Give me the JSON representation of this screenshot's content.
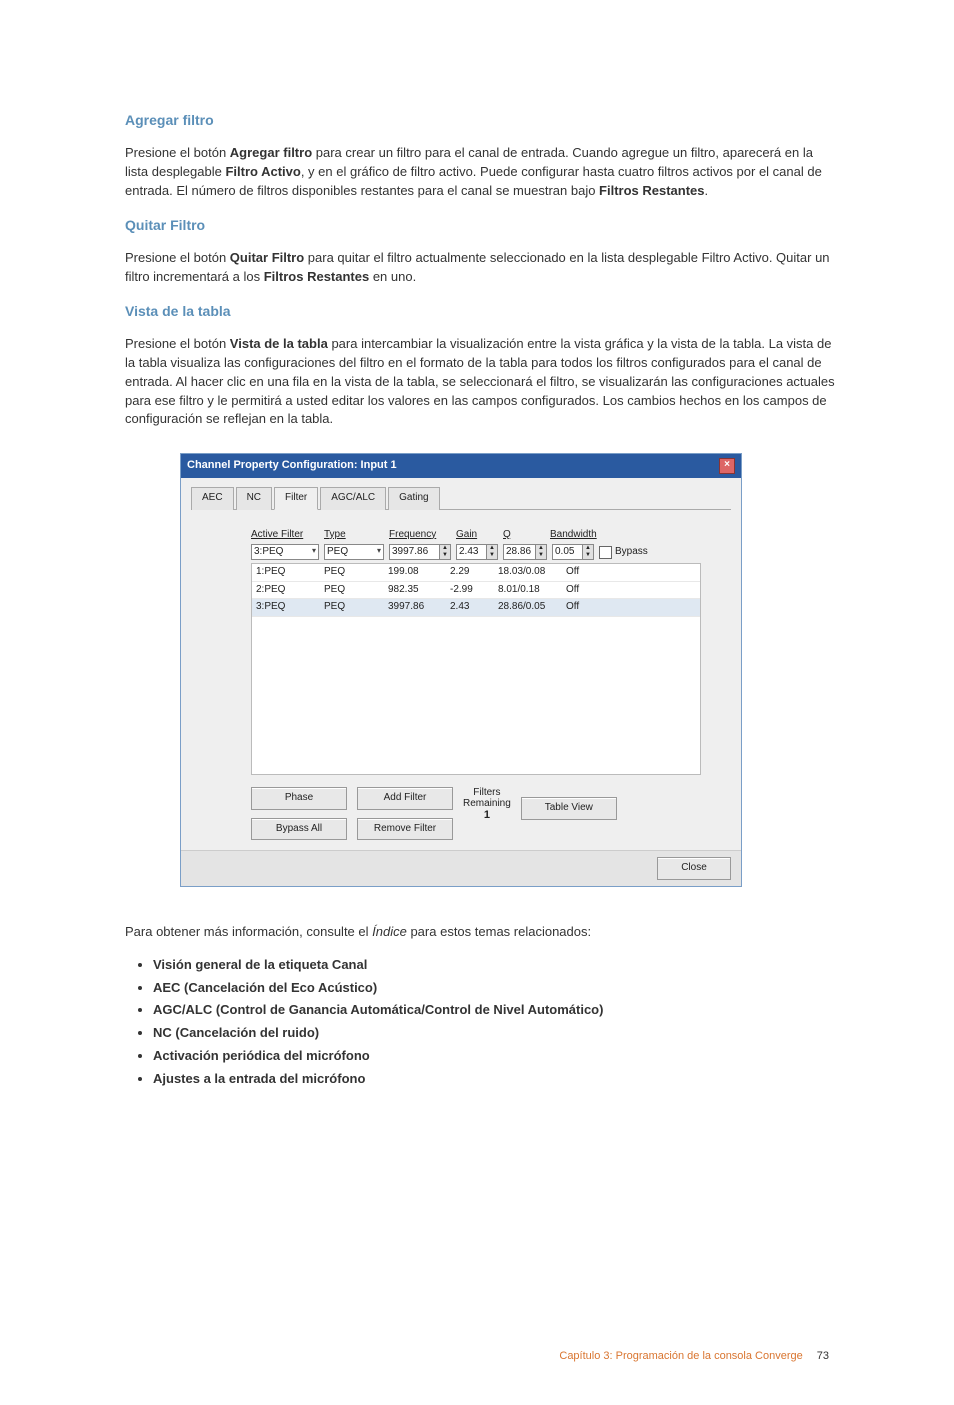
{
  "sections": {
    "add": {
      "heading": "Agregar filtro",
      "para_a": "Presione el botón ",
      "para_b": " para crear un filtro para el canal de entrada. Cuando agregue un filtro, aparecerá en la lista desplegable ",
      "para_c": ", y en el gráfico de filtro activo. Puede configurar hasta cuatro filtros activos por el canal de entrada. El número de filtros disponibles restantes para el canal se muestran bajo ",
      "bold1": "Agregar filtro",
      "bold2": "Filtro Activo",
      "bold3": "Filtros Restantes",
      "end": "."
    },
    "remove": {
      "heading": "Quitar Filtro",
      "para_a": "Presione el botón ",
      "para_b": " para quitar el filtro actualmente seleccionado en la lista desplegable Filtro Activo. Quitar un filtro incrementará a los ",
      "para_c": " en uno.",
      "bold1": "Quitar Filtro",
      "bold2": "Filtros Restantes"
    },
    "table": {
      "heading": "Vista de la tabla",
      "para_a": "Presione el botón ",
      "para_b": " para intercambiar la visualización entre la vista gráfica y la vista de la tabla. La vista de la tabla visualiza las configuraciones del filtro en el formato de la tabla para todos los filtros configurados para el canal de entrada. Al hacer clic en una fila en la vista de la tabla, se seleccionará el filtro, se visualizarán las configuraciones actuales para ese filtro y le permitirá a usted editar los valores en las campos configurados. Los cambios hechos en los campos de configuración se reflejan en la tabla.",
      "bold1": "Vista de la tabla"
    }
  },
  "dialog": {
    "title": "Channel Property Configuration: Input 1",
    "tabs": [
      "AEC",
      "NC",
      "Filter",
      "AGC/ALC",
      "Gating"
    ],
    "active_tab": 2,
    "labels": {
      "active_filter": "Active Filter",
      "type": "Type",
      "frequency": "Frequency",
      "gain": "Gain",
      "q": "Q",
      "bandwidth": "Bandwidth",
      "bypass": "Bypass"
    },
    "fields": {
      "active_filter": "3:PEQ",
      "type": "PEQ",
      "frequency": "3997.86",
      "gain": "2.43",
      "q": "28.86",
      "bandwidth": "0.05"
    },
    "rows": [
      {
        "name": "1:PEQ",
        "type": "PEQ",
        "freq": "199.08",
        "gain": "2.29",
        "qbw": "18.03/0.08",
        "bypass": "Off"
      },
      {
        "name": "2:PEQ",
        "type": "PEQ",
        "freq": "982.35",
        "gain": "-2.99",
        "qbw": "8.01/0.18",
        "bypass": "Off"
      },
      {
        "name": "3:PEQ",
        "type": "PEQ",
        "freq": "3997.86",
        "gain": "2.43",
        "qbw": "28.86/0.05",
        "bypass": "Off"
      }
    ],
    "buttons": {
      "phase": "Phase",
      "bypass_all": "Bypass All",
      "add_filter": "Add Filter",
      "remove_filter": "Remove Filter",
      "filters_remaining_label": "Filters\nRemaining",
      "filters_remaining_value": "1",
      "table_view": "Table View",
      "close": "Close"
    }
  },
  "more_info": {
    "lead_a": "Para obtener más información, consulte el ",
    "lead_i": "Índice",
    "lead_b": " para estos temas relacionados:",
    "items": [
      "Visión general de la etiqueta Canal",
      "AEC (Cancelación del Eco Acústico)",
      "AGC/ALC (Control de Ganancia Automática/Control de Nivel Automático)",
      "NC (Cancelación del ruido)",
      "Activación periódica del micrófono",
      "Ajustes a la entrada del micrófono"
    ]
  },
  "footer": {
    "chapter": "Capítulo 3: Programación de la consola Converge",
    "page": "73"
  }
}
